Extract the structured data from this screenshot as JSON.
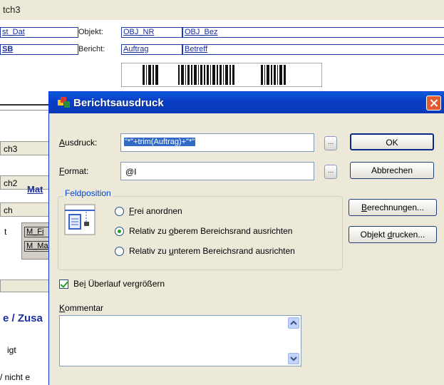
{
  "background": {
    "title_fragment": "tch3",
    "fields": [
      {
        "text": "st_Dat"
      },
      {
        "text": "SB"
      },
      {
        "text": "OBJ_NR"
      },
      {
        "text": "OBJ_Bez"
      },
      {
        "text": "Auftrag"
      },
      {
        "text": "Betreff"
      }
    ],
    "labels": [
      "Objekt:",
      "Bericht:"
    ],
    "bands": [
      "ch3",
      "ch2",
      "ch"
    ],
    "band_header": "Mat",
    "side_fields": [
      "M_Fi",
      "M_Ma"
    ],
    "section_label": "e / Zusa",
    "text_lines": [
      "igt",
      "/ nicht e"
    ],
    "left_fragment": "t"
  },
  "dialog": {
    "title": "Berichtsausdruck",
    "ausdruck_label_u": "A",
    "ausdruck_label_rest": "usdruck:",
    "ausdruck_value": "\"*\"+trim(Auftrag)+\"*\"",
    "format_label_u": "F",
    "format_label_rest": "ormat:",
    "format_value": "@I",
    "dots": "...",
    "ok": "OK",
    "cancel": "Abbrechen",
    "berechnungen_u": "B",
    "berechnungen_rest": "erechnungen...",
    "objekt_drucken_pre": "Objekt ",
    "objekt_drucken_u": "d",
    "objekt_drucken_rest": "rucken...",
    "feldposition_label": "Feldposition",
    "radio_options": [
      {
        "pre": "",
        "u": "F",
        "rest": "rei anordnen",
        "selected": false
      },
      {
        "pre": "Relativ zu ",
        "u": "o",
        "rest": "berem Bereichsrand ausrichten",
        "selected": true
      },
      {
        "pre": "Relativ zu ",
        "u": "u",
        "rest": "nterem Bereichsrand ausrichten",
        "selected": false
      }
    ],
    "checkbox_pre": "Be",
    "checkbox_u": "i",
    "checkbox_rest": " Überlauf vergrößern",
    "checkbox_checked": true,
    "kommentar_u": "K",
    "kommentar_rest": "ommentar"
  }
}
